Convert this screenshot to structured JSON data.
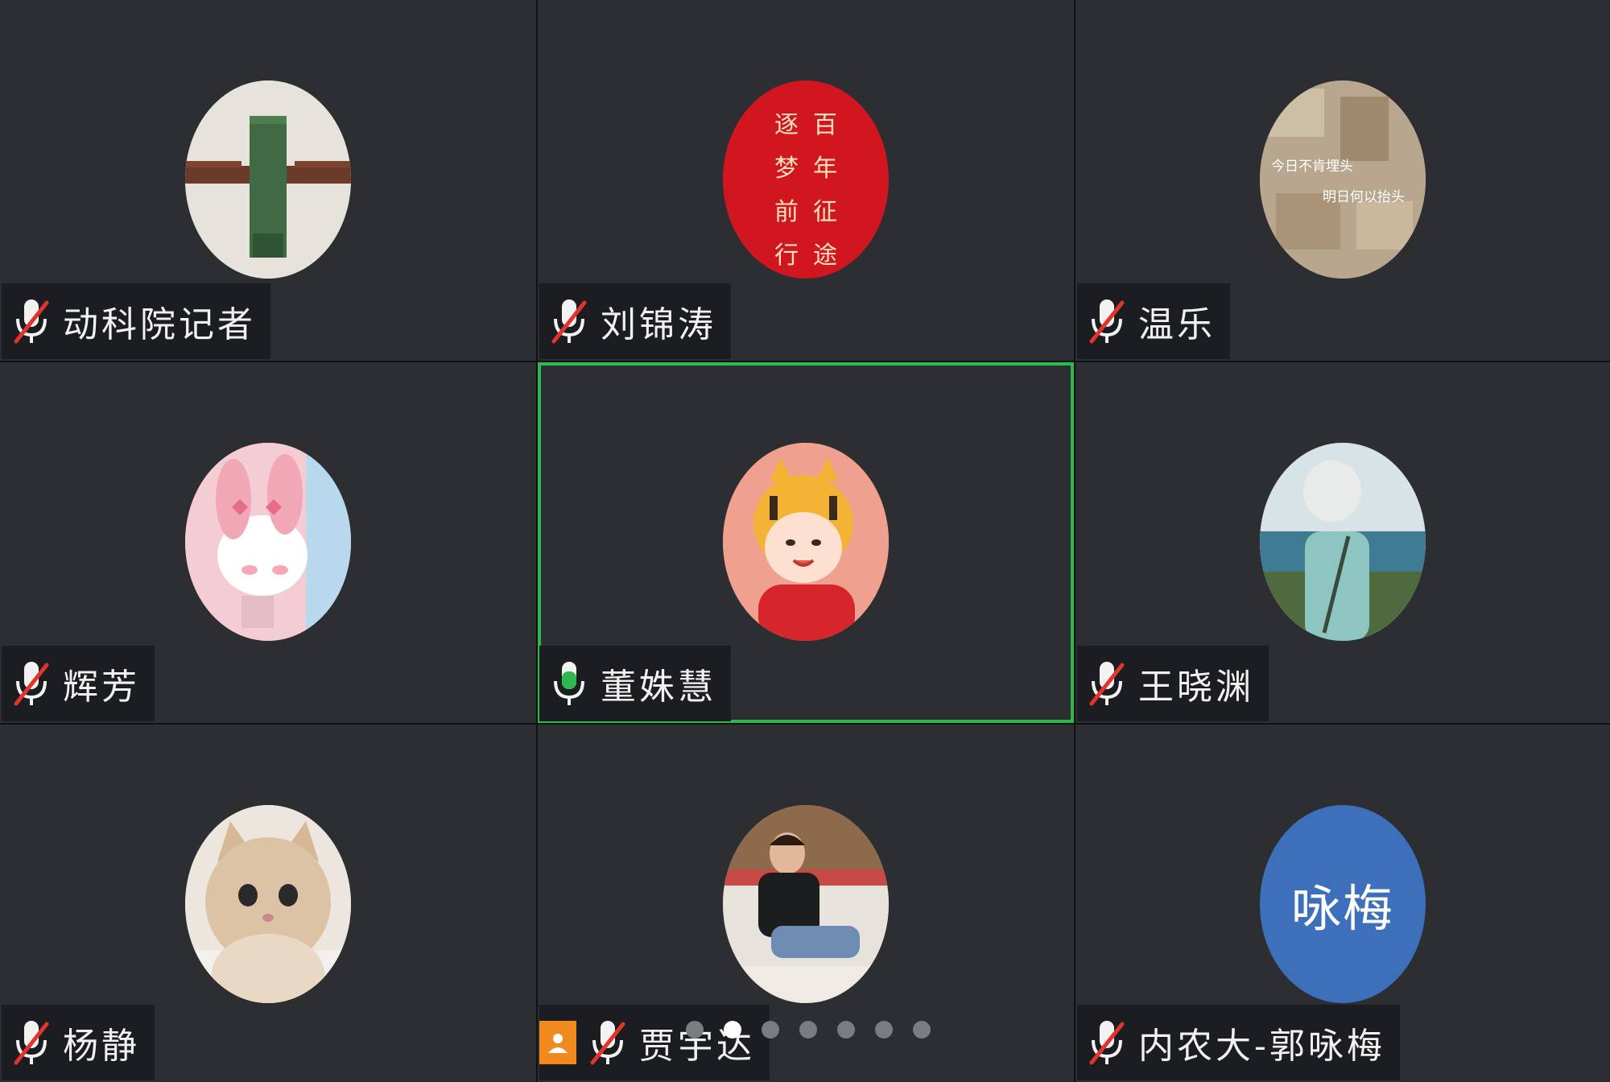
{
  "colors": {
    "tile_bg": "#2c2e32",
    "name_bar_bg": "#1c1d20",
    "active_border": "#2fb84f",
    "mic_muted_slash": "#e0342c",
    "mic_active": "#2fb84f",
    "host_badge": "#f08a1e"
  },
  "participants": [
    {
      "name": "动科院记者",
      "mic": "muted",
      "avatar": "lego-cross-photo"
    },
    {
      "name": "刘锦涛",
      "mic": "muted",
      "avatar": "red-slogan-image",
      "avatar_text": {
        "col1": [
          "逐",
          "梦",
          "前",
          "行"
        ],
        "col2": [
          "百",
          "年",
          "征",
          "途"
        ]
      }
    },
    {
      "name": "温乐",
      "mic": "muted",
      "avatar": "collage-image",
      "avatar_text": {
        "line1": "今日不肯埋头",
        "line2": "明日何以抬头"
      }
    },
    {
      "name": "辉芳",
      "mic": "muted",
      "avatar": "pink-bunny-cartoon"
    },
    {
      "name": "董姝慧",
      "mic": "active",
      "avatar": "tiger-hat-girl-cartoon",
      "active_speaker": true
    },
    {
      "name": "王晓渊",
      "mic": "muted",
      "avatar": "boy-by-sea-illustration"
    },
    {
      "name": "杨静",
      "mic": "muted",
      "avatar": "cat-photo"
    },
    {
      "name": "贾宇达",
      "mic": "muted",
      "avatar": "man-on-couch-photo",
      "host": true
    },
    {
      "name": "内农大-郭咏梅",
      "mic": "muted",
      "avatar": "text-initials",
      "avatar_text": {
        "initials": "咏梅"
      }
    }
  ],
  "pager": {
    "pages": 7,
    "current": 2
  }
}
